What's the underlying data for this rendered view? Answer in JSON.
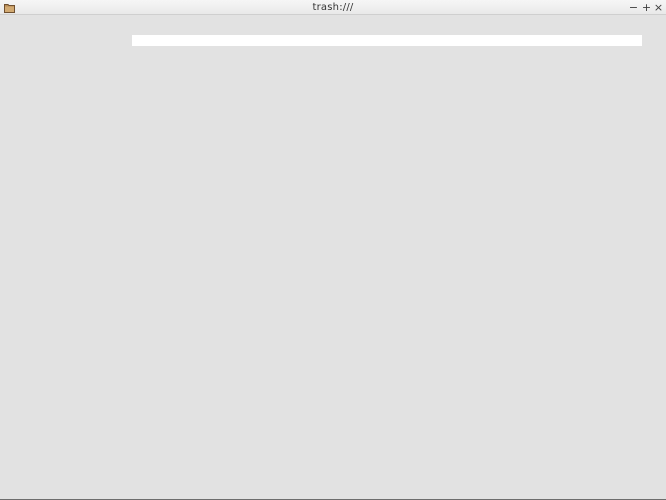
{
  "window": {
    "title": "trash:///",
    "controls": {
      "minimize_icon": "minimize-icon",
      "maximize_icon": "maximize-icon",
      "close_icon": "close-icon"
    },
    "app_icon": "folder-icon"
  },
  "content": {
    "location_bar": {
      "value": "",
      "placeholder": ""
    }
  }
}
